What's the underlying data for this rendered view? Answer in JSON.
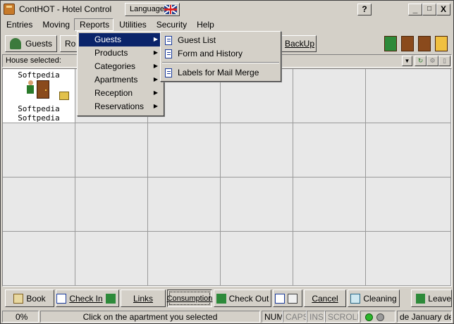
{
  "window": {
    "title": "ContHOT - Hotel Control",
    "language_label": "Language",
    "help_btn": "?",
    "min_btn": "_",
    "max_btn": "□",
    "close_btn": "X"
  },
  "menubar": [
    "Entries",
    "Moving",
    "Reports",
    "Utilities",
    "Security",
    "Help"
  ],
  "toolbar": {
    "guests": "Guests",
    "rooms_partial": "Ro",
    "backup": "BackUp"
  },
  "house": {
    "label": "House selected:"
  },
  "grid": {
    "cell": {
      "line1": "Softpedia",
      "line2": "Softpedia",
      "line3": "Softpedia"
    }
  },
  "reports_menu": [
    {
      "label": "Guests",
      "submenu": true,
      "selected": true
    },
    {
      "label": "Products",
      "submenu": true
    },
    {
      "label": "Categories",
      "submenu": true
    },
    {
      "label": "Apartments",
      "submenu": true
    },
    {
      "label": "Reception",
      "submenu": true
    },
    {
      "label": "Reservations",
      "submenu": true
    }
  ],
  "guests_submenu": [
    {
      "label": "Guest List"
    },
    {
      "label": "Form and History"
    },
    {
      "label": "Labels for Mail Merge"
    }
  ],
  "bottom": {
    "book": "Book",
    "checkin": "Check In",
    "links": "Links",
    "consumption": "Consumption",
    "checkout": "Check Out",
    "cancel": "Cancel",
    "cleaning": "Cleaning",
    "leave": "Leave"
  },
  "status": {
    "percent": "0%",
    "message": "Click on the apartment you selected",
    "num": "NUM",
    "caps": "CAPS",
    "ins": "INS",
    "scroll": "SCROLL",
    "date": "de January de"
  },
  "colors": {
    "face": "#d4d0c8",
    "highlight": "#0a246a",
    "cell_empty": "#e8e8e8",
    "led_green": "#2bb52b",
    "led_gray": "#9a9a9a"
  }
}
